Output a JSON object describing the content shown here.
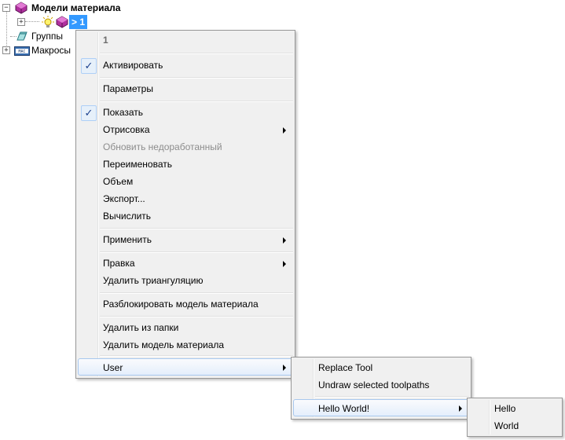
{
  "tree": {
    "root": {
      "label": "Модели материала",
      "expander": "−",
      "icon": "stock-models-icon"
    },
    "child": {
      "label": "> 1",
      "expander": "+",
      "icon": "stock-model-icon"
    },
    "groups": {
      "label": "Группы",
      "icon": "groups-icon"
    },
    "macros": {
      "label": "Макросы",
      "expander": "+",
      "icon": "macros-icon"
    }
  },
  "context_menu": {
    "header": "1",
    "activate": "Активировать",
    "parameters": "Параметры",
    "show": "Показать",
    "draw": "Отрисовка",
    "update": "Обновить недоработанный",
    "rename": "Переименовать",
    "volume": "Объем",
    "export": "Экспорт...",
    "calculate": "Вычислить",
    "apply": "Применить",
    "edit": "Правка",
    "delete_triangulation": "Удалить триангуляцию",
    "unlock": "Разблокировать модель материала",
    "remove_from_folder": "Удалить из папки",
    "delete_stock_model": "Удалить модель материала",
    "user": "User",
    "checkmark": "✓"
  },
  "user_submenu": {
    "replace_tool": "Replace Tool",
    "undraw": "Undraw selected toolpaths",
    "hello_world": "Hello World!"
  },
  "hello_submenu": {
    "hello": "Hello",
    "world": "World"
  }
}
